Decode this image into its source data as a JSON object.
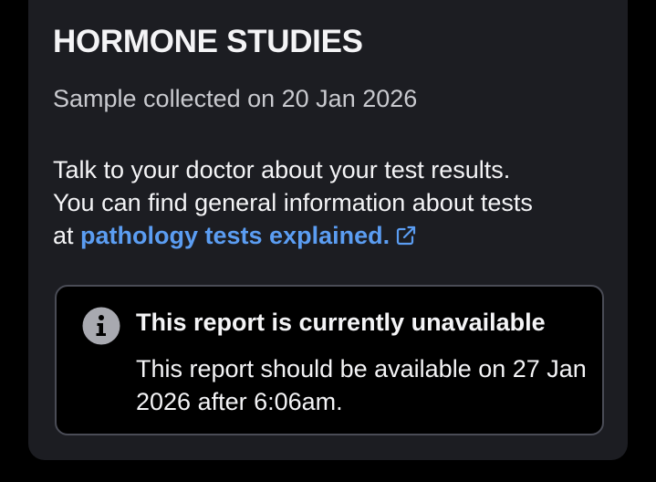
{
  "report": {
    "title": "HORMONE STUDIES",
    "collected": "Sample collected on 20 Jan 2026",
    "info_line1": "Talk to your doctor about your test results.",
    "info_line2": "You can find general information about tests",
    "info_prefix": "at ",
    "link_label": "pathology tests explained.",
    "link_icon": "external-link-icon"
  },
  "notice": {
    "icon": "info-icon",
    "title": "This report is currently unavailable",
    "body": "This report should be available on 27 Jan 2026 after 6:06am."
  },
  "colors": {
    "background": "#000000",
    "card": "#1c1d22",
    "text": "#f4f4f6",
    "muted_text": "#c9cacf",
    "link": "#5b9df2",
    "notice_border": "#4a4c56",
    "info_icon": "#a8a9b0"
  }
}
